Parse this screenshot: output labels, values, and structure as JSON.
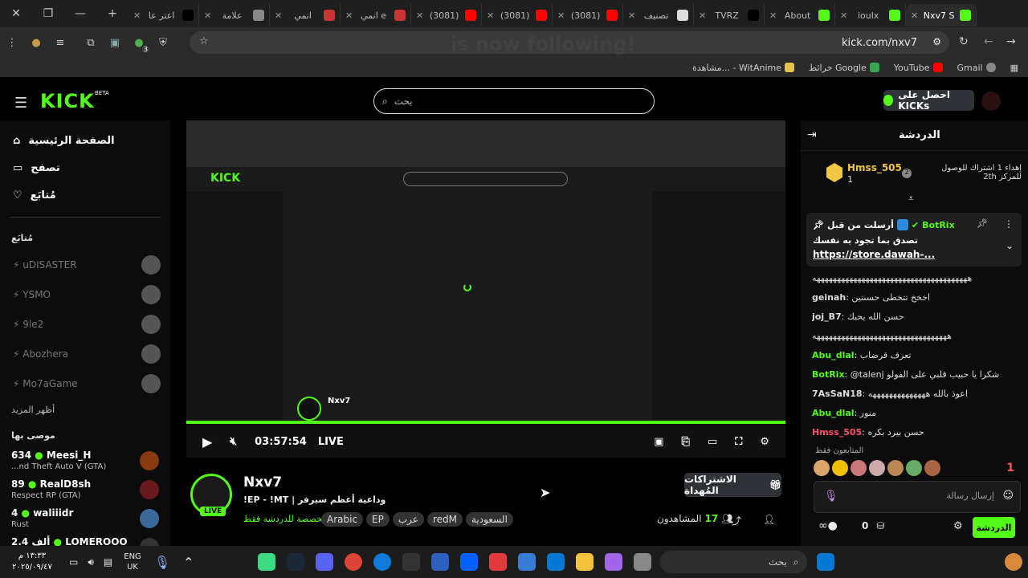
{
  "browser": {
    "tabs": [
      {
        "label": "اعتر عا",
        "active": false,
        "fav_color": "#000000"
      },
      {
        "label": "علامة",
        "active": false,
        "fav_color": "#888888"
      },
      {
        "label": "انمي",
        "active": false,
        "fav_color": "#cc3333"
      },
      {
        "label": "انمي e",
        "active": false,
        "fav_color": "#cc3333"
      },
      {
        "label": "(3081)",
        "active": false,
        "fav_color": "#ff0000"
      },
      {
        "label": "(3081)",
        "active": false,
        "fav_color": "#ff0000"
      },
      {
        "label": "(3081)",
        "active": false,
        "fav_color": "#ff0000"
      },
      {
        "label": "تصنيف",
        "active": false,
        "fav_color": "#dddddd"
      },
      {
        "label": "TVRZ",
        "active": false,
        "fav_color": "#000000"
      },
      {
        "label": "About",
        "active": false,
        "fav_color": "#53fc18"
      },
      {
        "label": "ioulx",
        "active": false,
        "fav_color": "#53fc18"
      },
      {
        "label": "Nxv7 S",
        "active": true,
        "fav_color": "#53fc18"
      }
    ],
    "url": "kick.com/nxv7",
    "overlay_text": "is now following!",
    "bookmarks": [
      {
        "label": "Gmail",
        "color": "#ea4335"
      },
      {
        "label": "YouTube",
        "color": "#ff0000"
      },
      {
        "label": "خرائط Google",
        "color": "#34a853"
      },
      {
        "label": "مشاهدة... - WitAnime",
        "color": "#e6c44a"
      }
    ],
    "ext_badge": "3"
  },
  "kick": {
    "logo": "KICK",
    "beta": "BETA",
    "search_placeholder": "بحث",
    "get_kicks": "احصل على KICKs"
  },
  "nav": {
    "home": "الصفحة الرئيسية",
    "browse": "تصفح",
    "following": "مُتابَع",
    "following_section": "مُتابَع",
    "followed": [
      {
        "name": "uDISASTER"
      },
      {
        "name": "YSMO"
      },
      {
        "name": "9le2"
      },
      {
        "name": "Abozhera"
      },
      {
        "name": "Mo7aGame"
      }
    ],
    "show_more": "أظهر المزيد",
    "recommended_section": "موصى بها",
    "recommended": [
      {
        "viewers": "634",
        "name": "Meesi_H",
        "game": "...nd Theft Auto V (GTA)",
        "color": "#8a3a10"
      },
      {
        "viewers": "89",
        "name": "RealD8sh",
        "game": "Respect RP (GTA)",
        "color": "#6a1a1a"
      },
      {
        "viewers": "4",
        "name": "waliiidr",
        "game": "Rust",
        "color": "#3a6a9a"
      },
      {
        "viewers": "2.4 ألف",
        "name": "LOMEROOO",
        "game": "",
        "color": "#333333"
      }
    ]
  },
  "player": {
    "time": "03:57:54",
    "live": "LIVE",
    "progress": 1.0
  },
  "stream": {
    "streamer": "Nxv7",
    "title": "!EP - !MT | وداعية أعظم سيرفر",
    "live": "LIVE",
    "followers_only": "مخصصة للدردشة فقط",
    "tags": [
      "Arabic",
      "EP",
      "عرب",
      "redM",
      "السعودية"
    ],
    "viewers_label": "المشاهدون",
    "viewers": "17",
    "gift_subs": "الاشتراكات المُهداة"
  },
  "chat": {
    "title": "الدردشة",
    "gift_count": "2",
    "gift_text": "إهداء 1 اشتراك للوصول للمركز 2th",
    "top_gifter": "Hmss_505",
    "top_gifter_count": "1",
    "pinned": {
      "sender": "BotRix",
      "sent_label": "أرسلت من قبل",
      "text": "تصدق بما تجود به نفسك",
      "link": "https://store.dawah-..."
    },
    "messages": [
      {
        "user": "",
        "text": "ههههههههههههههههههههههههههههههههههههههه",
        "color": "#cccccc"
      },
      {
        "user": "geinah",
        "text": "اخخخ تتخطى حسنتين",
        "color": "#dddddd"
      },
      {
        "user": "joj_B7",
        "text": "حسن الله يحبك",
        "color": "#dddddd"
      },
      {
        "user": "",
        "text": "هههههههههههههههههههههههههههههههههه",
        "color": "#cccccc"
      },
      {
        "user": "Abu_dlal",
        "text": "تعرف قرضاب",
        "color": "#53fc18"
      },
      {
        "user": "BotRix",
        "text": "@talenj شكرا يا حبيب قلبي على الفولو",
        "color": "#53fc18"
      },
      {
        "user": "7AsSaN18",
        "text": "اعوذ بالله ههههههههههههههه",
        "color": "#dddddd"
      },
      {
        "user": "Abu_dlal",
        "text": "منور",
        "color": "#53fc18"
      },
      {
        "user": "Hmss_505",
        "text": "حسن بيرد بكره",
        "color": "#ff4d6d"
      }
    ],
    "followers_only": "المتابعون فقط",
    "input_placeholder": "إرسال رسالة",
    "send_label": "الدردشة",
    "kicks_count": "0",
    "streak": "1"
  },
  "taskbar": {
    "search_placeholder": "بحث",
    "lang1": "ENG",
    "lang2": "UK",
    "time": "١٣:٣٣ م",
    "date": "٢٠٢٥/٠٩/٤٧"
  }
}
